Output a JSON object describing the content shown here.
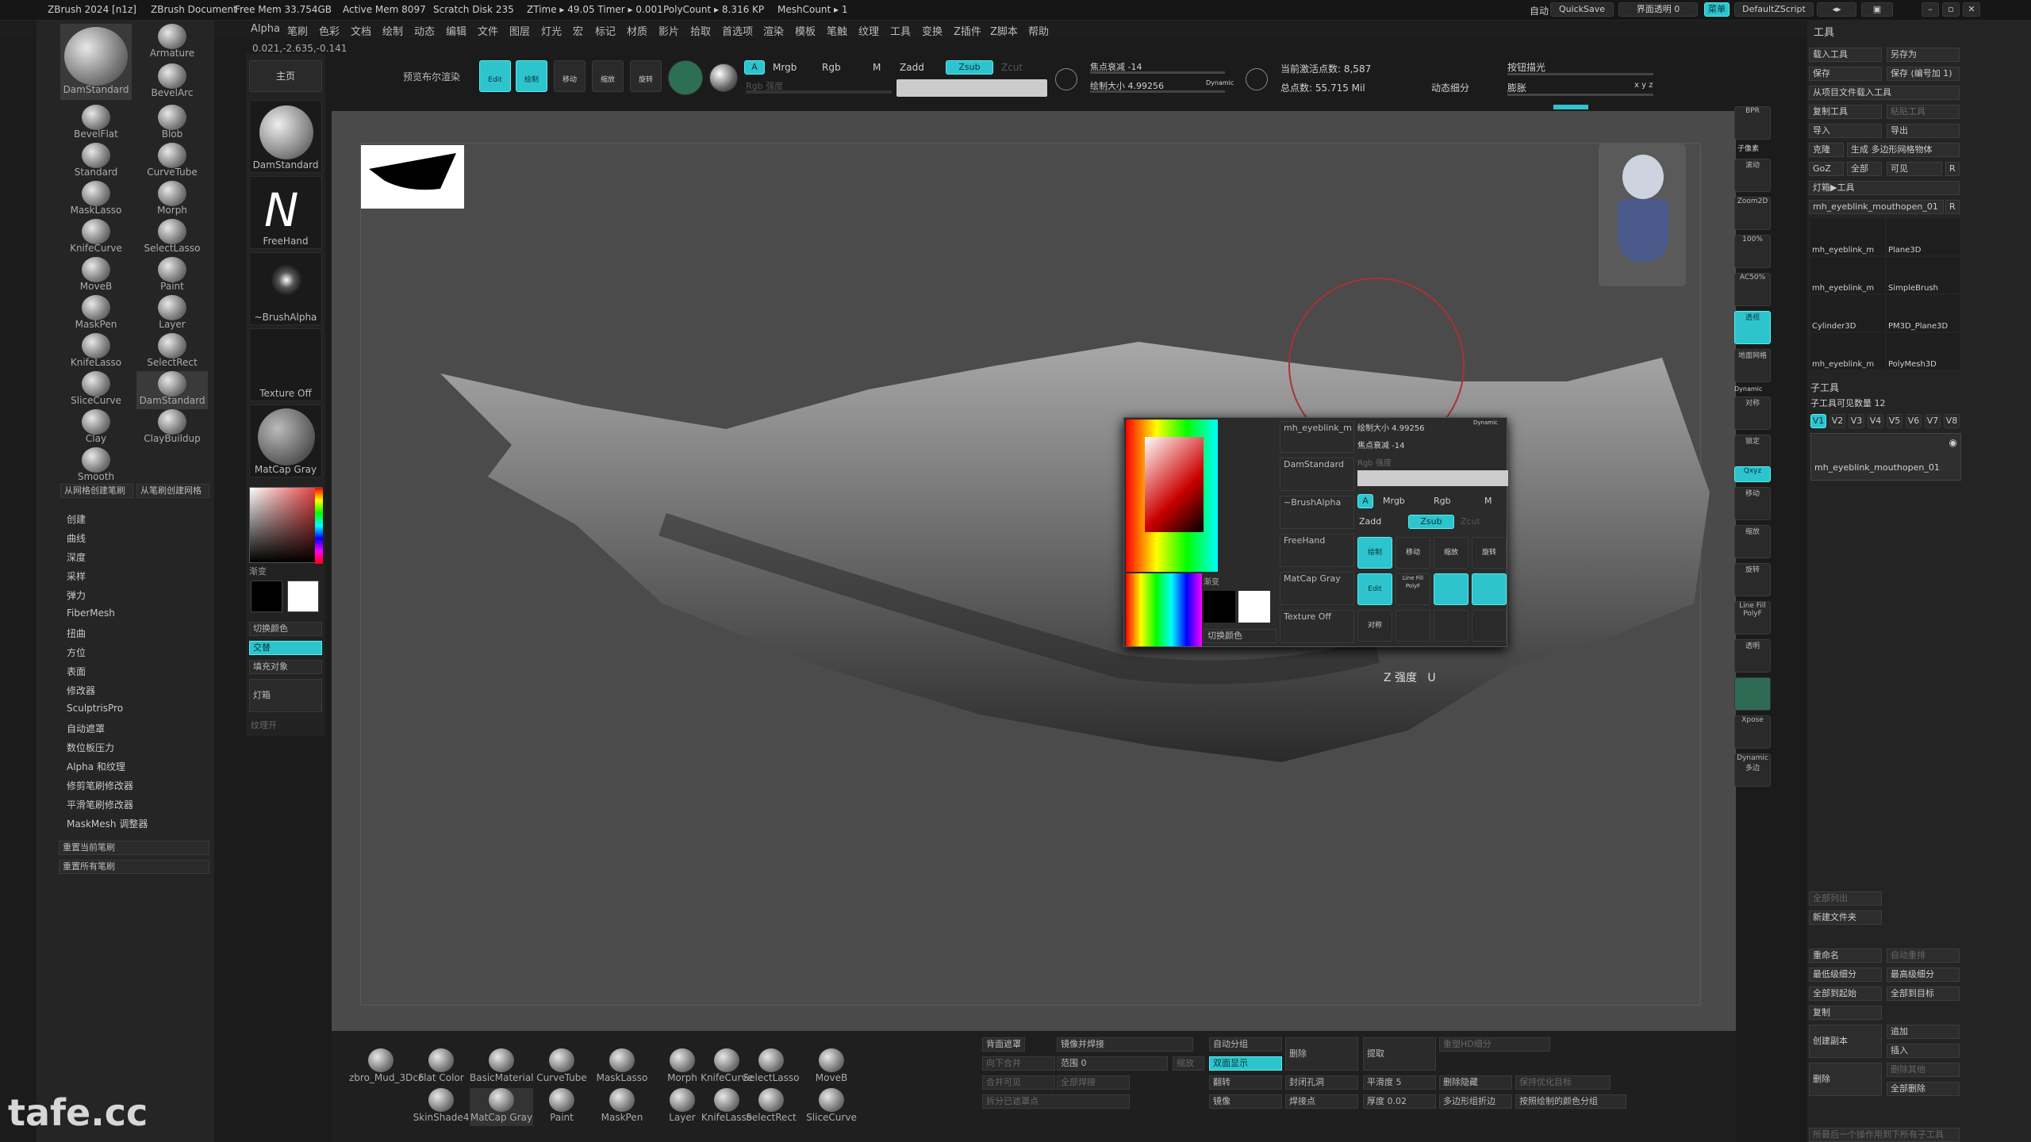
{
  "titlebar": {
    "app_title": "ZBrush 2024 [n1z]",
    "document": "ZBrush Document",
    "free_mem": "Free Mem 33.754GB",
    "active_mem": "Active Mem 8097",
    "scratch_disk": "Scratch Disk 235",
    "ztime": "ZTime ▸ 49.05 Timer ▸ 0.001",
    "polycount": "PolyCount ▸ 8.316 KP",
    "meshcount": "MeshCount ▸ 1",
    "auto_label": "自动",
    "quicksave": "QuickSave",
    "transparency": "界面透明 0",
    "menu_label": "菜单",
    "default_script": "DefaultZScript"
  },
  "menubar": {
    "items": [
      "Alpha",
      "笔刷",
      "色彩",
      "文档",
      "绘制",
      "动态",
      "编辑",
      "文件",
      "图层",
      "灯光",
      "宏",
      "标记",
      "材质",
      "影片",
      "拾取",
      "首选项",
      "渲染",
      "模板",
      "笔触",
      "纹理",
      "工具",
      "变换",
      "Z插件",
      "Z脚本",
      "帮助"
    ]
  },
  "coords": "0.021,-2.635,-0.141",
  "toolbar": {
    "home": "主页",
    "bool_render": "预览布尔渲染",
    "edit": "Edit",
    "draw": "绘制",
    "move": "移动",
    "scale": "缩放",
    "rotate": "旋转",
    "a": "A",
    "mrgb": "Mrgb",
    "rgb": "Rgb",
    "m": "M",
    "zadd": "Zadd",
    "zsub": "Zsub",
    "zcut": "Zcut",
    "rgb_intensity": "Rgb 强度",
    "focal": "焦点衰减 -14",
    "draw_size": "绘制大小 4.99256",
    "dynamic": "Dynamic",
    "active_points": "当前激活点数: 8,587",
    "total_points": "总点数: 55.715 Mil",
    "dyn_sub": "动态细分",
    "backlight": "按钮描光",
    "dilate": "膨胀",
    "xyz": "x y z"
  },
  "left_brushes": [
    {
      "label": "DamStandard"
    },
    {
      "label": "Armature"
    },
    {
      "label": "BevelFlat"
    },
    {
      "label": "BevelArc"
    },
    {
      "label": "Standard"
    },
    {
      "label": "Blob"
    },
    {
      "label": "MaskLasso"
    },
    {
      "label": "CurveTube"
    },
    {
      "label": "KnifeCurve"
    },
    {
      "label": "Morph"
    },
    {
      "label": "MoveB"
    },
    {
      "label": "SelectLasso"
    },
    {
      "label": "MaskPen"
    },
    {
      "label": "Paint"
    },
    {
      "label": "KnifeLasso"
    },
    {
      "label": "Layer"
    },
    {
      "label": "SliceCurve"
    },
    {
      "label": "SelectRect"
    },
    {
      "label": "Clay"
    },
    {
      "label": "DamStandard"
    },
    {
      "label": "Smooth"
    },
    {
      "label": "ClayBuildup"
    }
  ],
  "left_buttons": {
    "from_mesh_create": "从网格创建笔刷",
    "from_mesh_create2": "从笔刷创建网格",
    "reset_current": "重置当前笔刷",
    "reset_all": "重置所有笔刷"
  },
  "left_menu": [
    "创建",
    "曲线",
    "深度",
    "采样",
    "弹力",
    "FiberMesh",
    "扭曲",
    "方位",
    "表面",
    "修改器",
    "SculptrisPro",
    "自动遮罩",
    "数位板压力",
    "Alpha 和纹理",
    "修剪笔刷修改器",
    "平滑笔刷修改器",
    "MaskMesh 调整器"
  ],
  "brush_column": {
    "brush": "DamStandard",
    "stroke": "FreeHand",
    "alpha": "~BrushAlpha",
    "texture": "Texture Off",
    "material": "MatCap Gray",
    "gradient": "渐变",
    "switch_color": "切换颜色",
    "alternate": "交替",
    "fill": "填充对象",
    "light_box": "灯箱",
    "texture_hint": "纹理开"
  },
  "right_shelf": [
    "BPR",
    "子像素",
    "滚动",
    "Zoom2D",
    "100%",
    "AC50%",
    "透视",
    "地面网格",
    "Dynamic",
    "对称",
    "锁定",
    "Qxyz",
    "移动",
    "缩放",
    "旋转",
    "Line Fill PolyF",
    "透明",
    "Xpose",
    "Dynamic 多边"
  ],
  "right_panel": {
    "title": "工具",
    "load_tool": "载入工具",
    "save_as": "另存为",
    "save": "保存",
    "save_inc": "保存 (编号加 1)",
    "load_from_proj": "从项目文件载入工具",
    "copy_tool": "复制工具",
    "paste_tool": "粘贴工具",
    "import": "导入",
    "export": "导出",
    "clone": "克隆",
    "make_polymesh": "生成 多边形网格物体",
    "goz": "GoZ",
    "all": "全部",
    "visible": "可见",
    "r": "R",
    "lightbox_tool": "灯箱▶工具",
    "current_tool": "mh_eyeblink_mouthopen_01",
    "r2": "R",
    "tools": [
      "mh_eyeblink_m",
      "Plane3D",
      "mh_eyeblink_m",
      "SimpleBrush",
      "Cylinder3D",
      "PM3D_Plane3D",
      "mh_eyeblink_m",
      "PolyMesh3D"
    ],
    "subtool_header": "子工具",
    "subtool_count": "子工具可见数量 12",
    "versions": [
      "V1",
      "V2",
      "V3",
      "V4",
      "V5",
      "V6",
      "V7",
      "V8"
    ],
    "subtool_name": "mh_eyeblink_mouthopen_01",
    "list_all": "全部列出",
    "new_folder": "新建文件夹",
    "rename": "重命名",
    "auto_rearrange": "自动重排",
    "lowest_subdiv": "最低级细分",
    "highest_subdiv": "最高级细分",
    "all_to_start": "全部到起始",
    "all_to_target": "全部到目标",
    "duplicate": "复制",
    "append": "追加",
    "insert": "插入",
    "create_copy": "创建副本",
    "delete": "删除",
    "delete_others": "删除其他",
    "delete_all": "全部删除",
    "hint": "所最后一个操作用到下所有子工具"
  },
  "bottom": {
    "tools": [
      {
        "label": "zbro_Mud_3Dco"
      },
      {
        "label": "Flat Color"
      },
      {
        "label": "BasicMaterial"
      },
      {
        "label": "CurveTube"
      },
      {
        "label": "MaskLasso"
      },
      {
        "label": "Morph"
      },
      {
        "label": "KnifeCurve"
      },
      {
        "label": "SelectLasso"
      },
      {
        "label": "MoveB"
      },
      {
        "label": "SkinShade4"
      },
      {
        "label": "MatCap Gray"
      },
      {
        "label": "Paint"
      },
      {
        "label": "MaskPen"
      },
      {
        "label": "Layer"
      },
      {
        "label": "KnifeLasso"
      },
      {
        "label": "SelectRect"
      },
      {
        "label": "SliceCurve"
      }
    ],
    "panel": {
      "bg_mask": "背面遮罩",
      "mirror_weld": "镜像并焊接",
      "auto_group": "自动分组",
      "delete": "删除",
      "extract": "提取",
      "reproject": "重塑HD细分",
      "merge_down": "向下合并",
      "range": "范围 0",
      "grow": "缩放",
      "double": "双面显示",
      "merge_tool": "合并可见",
      "all_weld": "全部焊接",
      "flip": "翻转",
      "close_holes": "封闭孔洞",
      "smooth": "平滑度 5",
      "delete_hidden": "删除隐藏",
      "preserve": "保持优化目标",
      "split_hidden": "拆分已遮罩点",
      "mirror": "镜像",
      "weld_point": "焊接点",
      "thickness": "厚度 0.02",
      "poly_paint": "多边形组折边",
      "grp_color": "按照绘制的颜色分组"
    }
  },
  "popup": {
    "draw_size": "绘制大小 4.99256",
    "focal": "焦点衰减 -14",
    "rgb_intensity": "Rgb 强度",
    "dynamic": "Dynamic",
    "tool_name": "mh_eyeblink_m",
    "brush": "DamStandard",
    "alpha": "~BrushAlpha",
    "stroke": "FreeHand",
    "material": "MatCap Gray",
    "texture": "Texture Off",
    "gradient": "渐变",
    "switch_color": "切换颜色",
    "a": "A",
    "mrgb": "Mrgb",
    "rgb": "Rgb",
    "m": "M",
    "zadd": "Zadd",
    "zsub": "Zsub",
    "zcut": "Zcut",
    "edit": "Edit",
    "draw": "绘制",
    "move": "移动",
    "scale": "缩放",
    "rotate": "旋转",
    "sym": "对称",
    "line_fill": "Line Fill PolyF",
    "zintensity": "Z 强度",
    "u": "U"
  },
  "watermark": "tafe.cc"
}
